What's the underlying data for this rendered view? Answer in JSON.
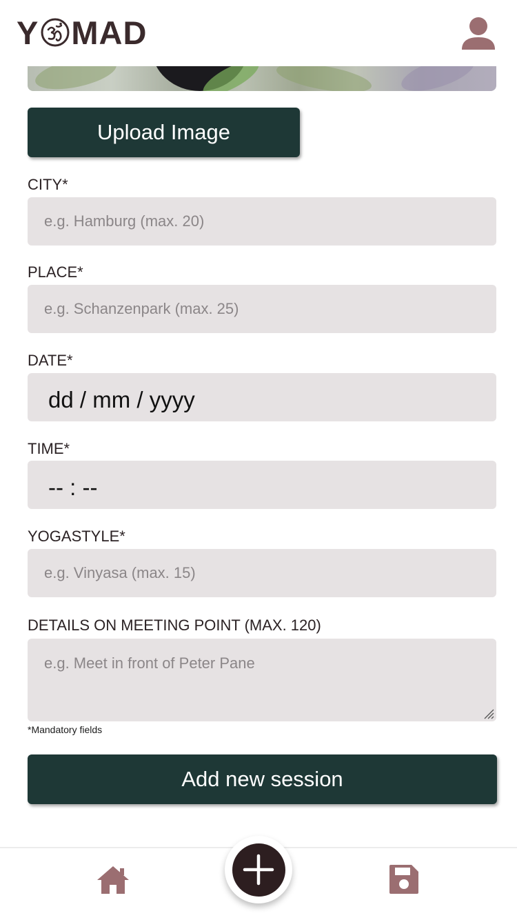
{
  "app": {
    "logo_left": "Y",
    "logo_right": "MAD",
    "logo_symbol": "om-symbol"
  },
  "colors": {
    "brand_dark": "#1e3836",
    "accent": "#9b6e71",
    "field_bg": "#e6e2e3",
    "nav_center": "#2d1e20"
  },
  "upload_button": {
    "label": "Upload Image"
  },
  "form": {
    "city": {
      "label": "CITY*",
      "placeholder": "e.g. Hamburg (max. 20)"
    },
    "place": {
      "label": "PLACE*",
      "placeholder": "e.g. Schanzenpark (max. 25)"
    },
    "date": {
      "label": "DATE*",
      "value": "dd / mm / yyyy"
    },
    "time": {
      "label": "TIME*",
      "value": "-- : --"
    },
    "yogastyle": {
      "label": "YOGASTYLE*",
      "placeholder": "e.g. Vinyasa (max. 15)"
    },
    "details": {
      "label": "DETAILS ON MEETING POINT (MAX. 120)",
      "placeholder": "e.g. Meet in front of Peter Pane"
    },
    "mandatory_note": "*Mandatory fields",
    "submit_label": "Add new session"
  },
  "nav": {
    "home_icon": "home-icon",
    "add_icon": "plus-icon",
    "save_icon": "floppy-disk-icon"
  }
}
